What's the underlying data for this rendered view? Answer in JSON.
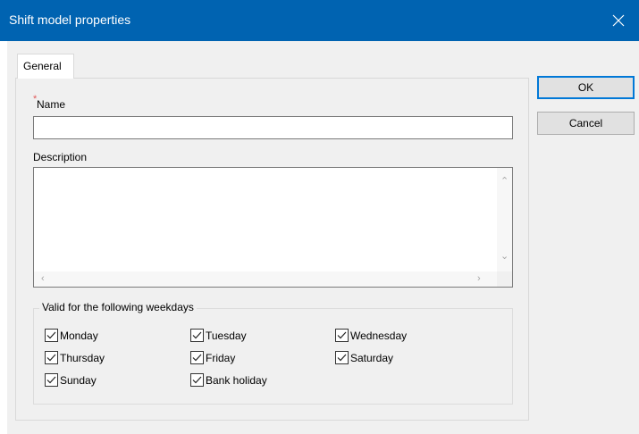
{
  "window": {
    "title": "Shift model properties",
    "close_icon": "close-icon"
  },
  "tabs": [
    {
      "label": "General",
      "selected": true
    }
  ],
  "form": {
    "required_marker": "*",
    "name_label": "Name",
    "name_value": "",
    "description_label": "Description",
    "description_value": ""
  },
  "weekdays": {
    "legend": "Valid for the following weekdays",
    "items": [
      {
        "label": "Monday",
        "checked": true
      },
      {
        "label": "Tuesday",
        "checked": true
      },
      {
        "label": "Wednesday",
        "checked": true
      },
      {
        "label": "Thursday",
        "checked": true
      },
      {
        "label": "Friday",
        "checked": true
      },
      {
        "label": "Saturday",
        "checked": true
      },
      {
        "label": "Sunday",
        "checked": true
      },
      {
        "label": "Bank holiday",
        "checked": true
      }
    ]
  },
  "buttons": {
    "ok": "OK",
    "cancel": "Cancel"
  },
  "colors": {
    "titlebar": "#0063b1",
    "dialog_bg": "#f0f0f0",
    "required": "#e05a5a",
    "default_button_border": "#0078d7"
  }
}
